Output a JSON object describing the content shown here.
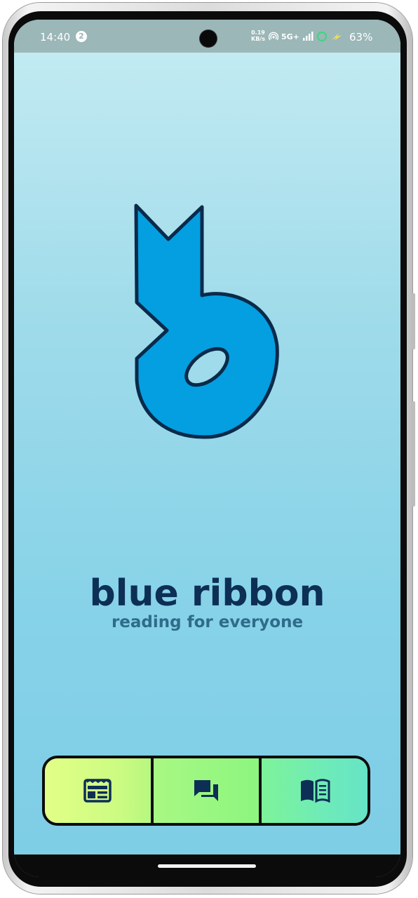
{
  "status_bar": {
    "time": "14:40",
    "notification_count": "2",
    "net_speed_value": "0.19",
    "net_speed_unit": "KB/s",
    "network": "5G+",
    "battery": "63%"
  },
  "app": {
    "title": "blue ribbon",
    "tagline": "reading for everyone"
  },
  "nav": {
    "items": [
      {
        "name": "news",
        "icon": "newspaper-icon"
      },
      {
        "name": "chat",
        "icon": "chat-icon"
      },
      {
        "name": "read",
        "icon": "open-book-icon"
      }
    ]
  },
  "colors": {
    "background_top": "#c6ecf3",
    "background_bottom": "#7dcde6",
    "logo_fill": "#039fe1",
    "logo_stroke": "#0b2a4a",
    "title": "#0d2f55",
    "tagline": "#2e6c8a"
  }
}
